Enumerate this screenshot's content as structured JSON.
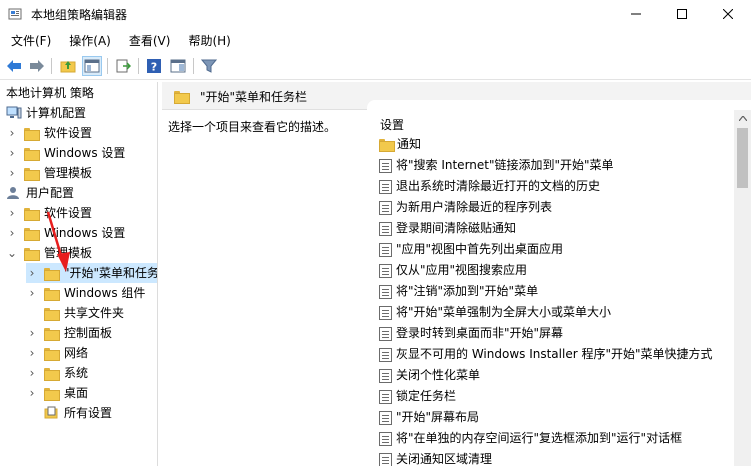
{
  "window": {
    "title": "本地组策略编辑器"
  },
  "menu": [
    "文件(F)",
    "操作(A)",
    "查看(V)",
    "帮助(H)"
  ],
  "toolbar": {
    "buttons": [
      "back-icon",
      "forward-icon",
      "up-folder-icon",
      "show-hide-tree-icon",
      "export-list-icon",
      "help-icon",
      "properties-view-icon",
      "filter-icon"
    ]
  },
  "tree": [
    {
      "label": "本地计算机 策略"
    },
    {
      "label": "计算机配置"
    },
    {
      "label": "软件设置"
    },
    {
      "label": "Windows 设置"
    },
    {
      "label": "管理模板"
    },
    {
      "label": "用户配置"
    },
    {
      "label": "软件设置"
    },
    {
      "label": "Windows 设置"
    },
    {
      "label": "管理模板"
    },
    {
      "label": "\"开始\"菜单和任务"
    },
    {
      "label": "Windows 组件"
    },
    {
      "label": "共享文件夹"
    },
    {
      "label": "控制面板"
    },
    {
      "label": "网络"
    },
    {
      "label": "系统"
    },
    {
      "label": "桌面"
    },
    {
      "label": "所有设置"
    }
  ],
  "right_header": {
    "title": "\"开始\"菜单和任务栏"
  },
  "description": "选择一个项目来查看它的描述。",
  "list": {
    "column": "设置",
    "items": [
      {
        "label": "通知",
        "kind": "folder"
      },
      {
        "label": "将\"搜索 Internet\"链接添加到\"开始\"菜单",
        "kind": "setting"
      },
      {
        "label": "退出系统时清除最近打开的文档的历史",
        "kind": "setting"
      },
      {
        "label": "为新用户清除最近的程序列表",
        "kind": "setting"
      },
      {
        "label": "登录期间清除磁贴通知",
        "kind": "setting"
      },
      {
        "label": "\"应用\"视图中首先列出桌面应用",
        "kind": "setting"
      },
      {
        "label": "仅从\"应用\"视图搜索应用",
        "kind": "setting"
      },
      {
        "label": "将\"注销\"添加到\"开始\"菜单",
        "kind": "setting"
      },
      {
        "label": "将\"开始\"菜单强制为全屏大小或菜单大小",
        "kind": "setting"
      },
      {
        "label": "登录时转到桌面而非\"开始\"屏幕",
        "kind": "setting"
      },
      {
        "label": "灰显不可用的 Windows Installer 程序\"开始\"菜单快捷方式",
        "kind": "setting"
      },
      {
        "label": "关闭个性化菜单",
        "kind": "setting"
      },
      {
        "label": "锁定任务栏",
        "kind": "setting"
      },
      {
        "label": "\"开始\"屏幕布局",
        "kind": "setting"
      },
      {
        "label": "将\"在单独的内存空间运行\"复选框添加到\"运行\"对话框",
        "kind": "setting"
      },
      {
        "label": "关闭通知区域清理",
        "kind": "setting"
      }
    ]
  },
  "colors": {
    "selection": "#cce8ff",
    "accent": "#1e6fd0",
    "arrow": "#e81e1e"
  }
}
